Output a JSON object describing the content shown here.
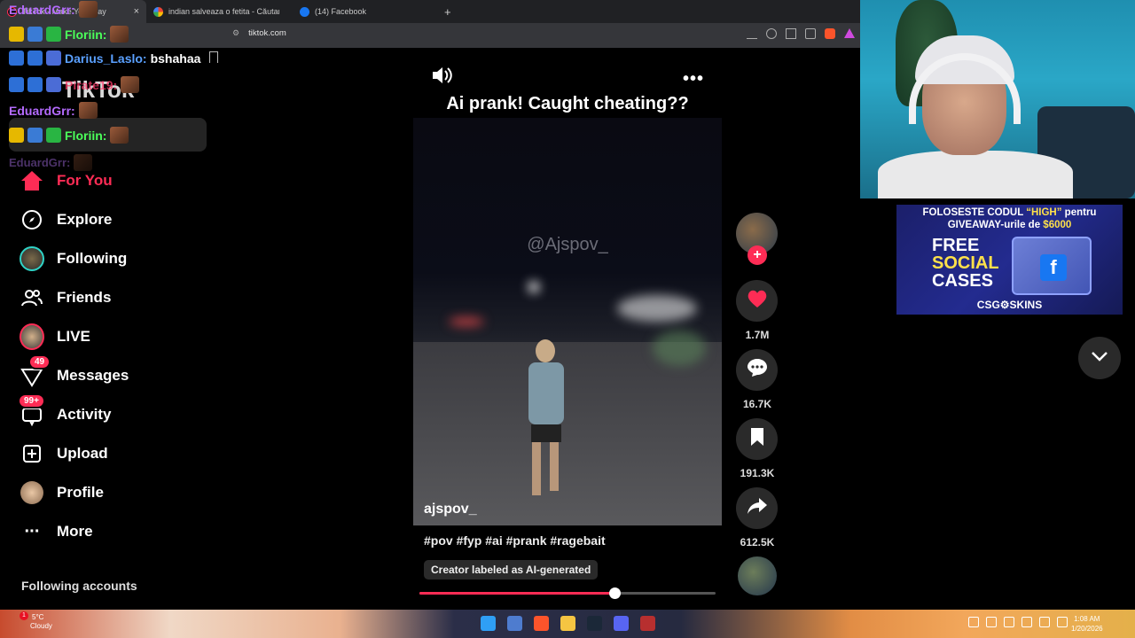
{
  "browser": {
    "tabs": [
      {
        "title": "TikTok - Make Your Day",
        "active": true
      },
      {
        "title": "indian salveaza o fetita - Căutare Google",
        "active": false
      },
      {
        "title": "(14) Facebook",
        "active": false
      }
    ],
    "url": "tiktok.com",
    "new_tab_symbol": "+",
    "close_symbol": "×"
  },
  "chat": [
    {
      "user": "EduardGrr:",
      "message": "",
      "color": "#b56bff"
    },
    {
      "user": "Floriin:",
      "message": "",
      "color": "#4bff5a"
    },
    {
      "user": "Darius_Laslo:",
      "message": "bshahaa",
      "color": "#5aa0ff"
    },
    {
      "user": "Pirate19:",
      "message": "",
      "color": "#ff3b6b"
    },
    {
      "user": "EduardGrr:",
      "message": "",
      "color": "#b56bff"
    },
    {
      "user": "Floriin:",
      "message": "",
      "color": "#4bff5a"
    },
    {
      "user": "EduardGrr:",
      "message": "",
      "color": "#8a5bbf"
    }
  ],
  "logo": "TikTok",
  "sidebar": {
    "items": [
      {
        "label": "For You",
        "icon": "home-icon",
        "active": true
      },
      {
        "label": "Explore",
        "icon": "compass-icon"
      },
      {
        "label": "Following",
        "icon": "following-avatar-icon"
      },
      {
        "label": "Friends",
        "icon": "friends-icon"
      },
      {
        "label": "LIVE",
        "icon": "live-avatar-icon"
      },
      {
        "label": "Messages",
        "icon": "messages-icon",
        "badge": "49"
      },
      {
        "label": "Activity",
        "icon": "activity-icon",
        "badge": "99+"
      },
      {
        "label": "Upload",
        "icon": "upload-icon"
      },
      {
        "label": "Profile",
        "icon": "profile-avatar-icon"
      },
      {
        "label": "More",
        "icon": "more-dots-icon"
      }
    ],
    "following_accounts": "Following accounts"
  },
  "video": {
    "title": "Ai prank! Caught cheating??",
    "watermark": "@Ajspov_",
    "creator": "ajspov_",
    "hashtags": "#pov #fyp #ai #prank #ragebait",
    "ai_label": "Creator labeled as AI-generated",
    "progress": 0.66
  },
  "actions": {
    "likes": "1.7M",
    "comments": "16.7K",
    "saves": "191.3K",
    "shares": "612.5K",
    "follow_symbol": "+"
  },
  "ad": {
    "line1_a": "FOLOSESTE CODUL ",
    "line1_b": "“HIGH”",
    "line1_c": " pentru",
    "line2_a": "GIVEAWAY-urile de ",
    "line2_b": "$6000",
    "free": "FREE",
    "social": "SOCIAL",
    "cases": "CASES",
    "brand": "CSG⚙SKINS"
  },
  "taskbar": {
    "temp": "5°C",
    "weather": "Cloudy",
    "time": "1:08 AM",
    "date": "1/20/2026",
    "notification_count": "1"
  },
  "colors": {
    "accent": "#fe2c55",
    "background": "#000000"
  }
}
